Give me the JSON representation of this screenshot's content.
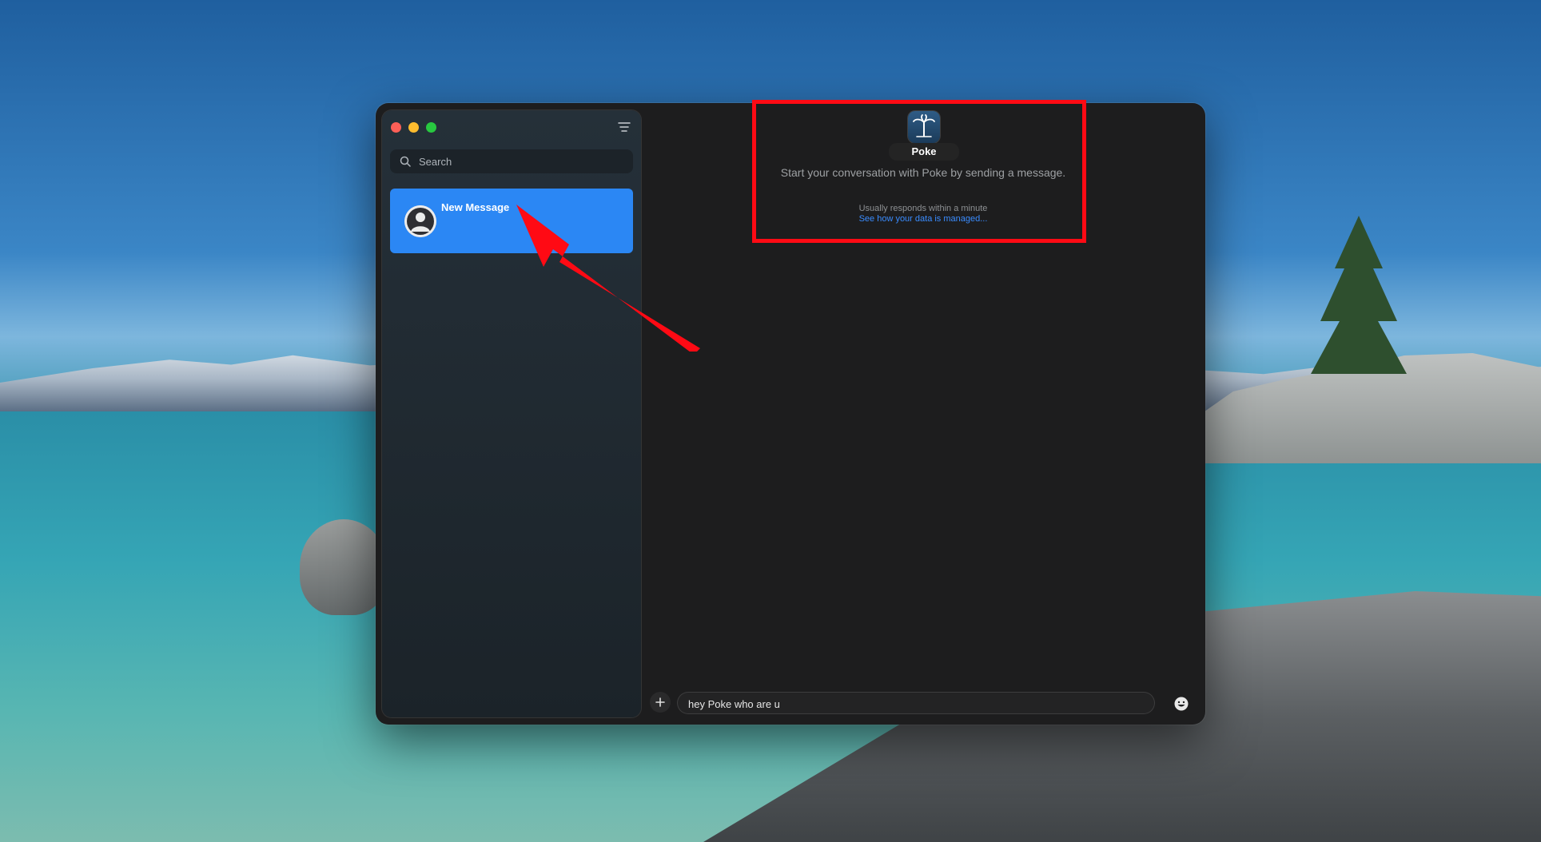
{
  "sidebar": {
    "search": {
      "placeholder": "Search"
    },
    "conversations": [
      {
        "title": "New Message",
        "selected": true
      }
    ]
  },
  "conversation": {
    "contact_name": "Poke",
    "start_text": "Start your conversation with Poke by sending a message.",
    "response_time": "Usually responds within a minute",
    "data_link": "See how your data is managed..."
  },
  "composer": {
    "value": "hey Poke who are u"
  },
  "colors": {
    "accent": "#2b87f4",
    "annotation": "#ff0a14",
    "link": "#3a8cff"
  },
  "icons": {
    "search": "search-icon",
    "compose": "compose-icon",
    "plus": "plus-icon",
    "emoji": "emoji-icon",
    "app": "palm-tree-icon",
    "avatar": "person-icon"
  }
}
